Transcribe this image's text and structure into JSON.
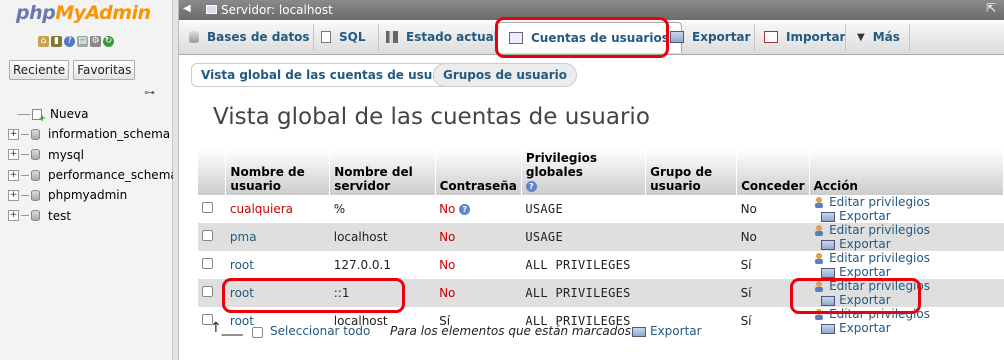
{
  "nav": {
    "logo_php": "php",
    "logo_myadmin": "MyAdmin",
    "quick_icons": [
      "home-icon",
      "exit-icon",
      "help-icon",
      "docs-icon",
      "settings-icon",
      "reload-icon"
    ],
    "tabs": [
      "Reciente",
      "Favoritas"
    ],
    "tree": [
      {
        "label": "Nueva",
        "type": "new"
      },
      {
        "label": "information_schema",
        "type": "db"
      },
      {
        "label": "mysql",
        "type": "db"
      },
      {
        "label": "performance_schema",
        "type": "db"
      },
      {
        "label": "phpmyadmin",
        "type": "db"
      },
      {
        "label": "test",
        "type": "db"
      }
    ]
  },
  "serverbar": {
    "title": "Servidor: localhost"
  },
  "topmenu": {
    "tabs": [
      "Bases de datos",
      "SQL",
      "Estado actual",
      "Cuentas de usuarios",
      "Exportar",
      "Importar",
      "Más"
    ],
    "active": "Cuentas de usuarios"
  },
  "subtabs": [
    "Vista global de las cuentas de usuario",
    "Grupos de usuario"
  ],
  "page_title": "Vista global de las cuentas de usuario",
  "table": {
    "headers": {
      "user": [
        "Nombre de",
        "usuario"
      ],
      "host": [
        "Nombre del",
        "servidor"
      ],
      "password": "Contraseña",
      "privileges": "Privilegios globales",
      "group": [
        "Grupo de",
        "usuario"
      ],
      "grant": "Conceder",
      "action": "Acción"
    },
    "rows": [
      {
        "user": "cualquiera",
        "host": "%",
        "password": "No",
        "privileges": "USAGE",
        "group": "",
        "grant": "No",
        "edit": "Editar privilegios",
        "export": "Exportar"
      },
      {
        "user": "pma",
        "host": "localhost",
        "password": "No",
        "privileges": "USAGE",
        "group": "",
        "grant": "No",
        "edit": "Editar privilegios",
        "export": "Exportar"
      },
      {
        "user": "root",
        "host": "127.0.0.1",
        "password": "No",
        "privileges": "ALL PRIVILEGES",
        "group": "",
        "grant": "Sí",
        "edit": "Editar privilegios",
        "export": "Exportar"
      },
      {
        "user": "root",
        "host": "::1",
        "password": "No",
        "privileges": "ALL PRIVILEGES",
        "group": "",
        "grant": "Sí",
        "edit": "Editar privilegios",
        "export": "Exportar"
      },
      {
        "user": "root",
        "host": "localhost",
        "password": "Sí",
        "privileges": "ALL PRIVILEGES",
        "group": "",
        "grant": "Sí",
        "edit": "Editar privilegios",
        "export": "Exportar"
      }
    ]
  },
  "footer": {
    "select_all": "Seleccionar todo",
    "with_selected": "Para los elementos que están marcados:",
    "export": "Exportar"
  },
  "colors": {
    "link": "#235a81",
    "no_password": "#cc0000",
    "annotation": "#e8000b"
  }
}
